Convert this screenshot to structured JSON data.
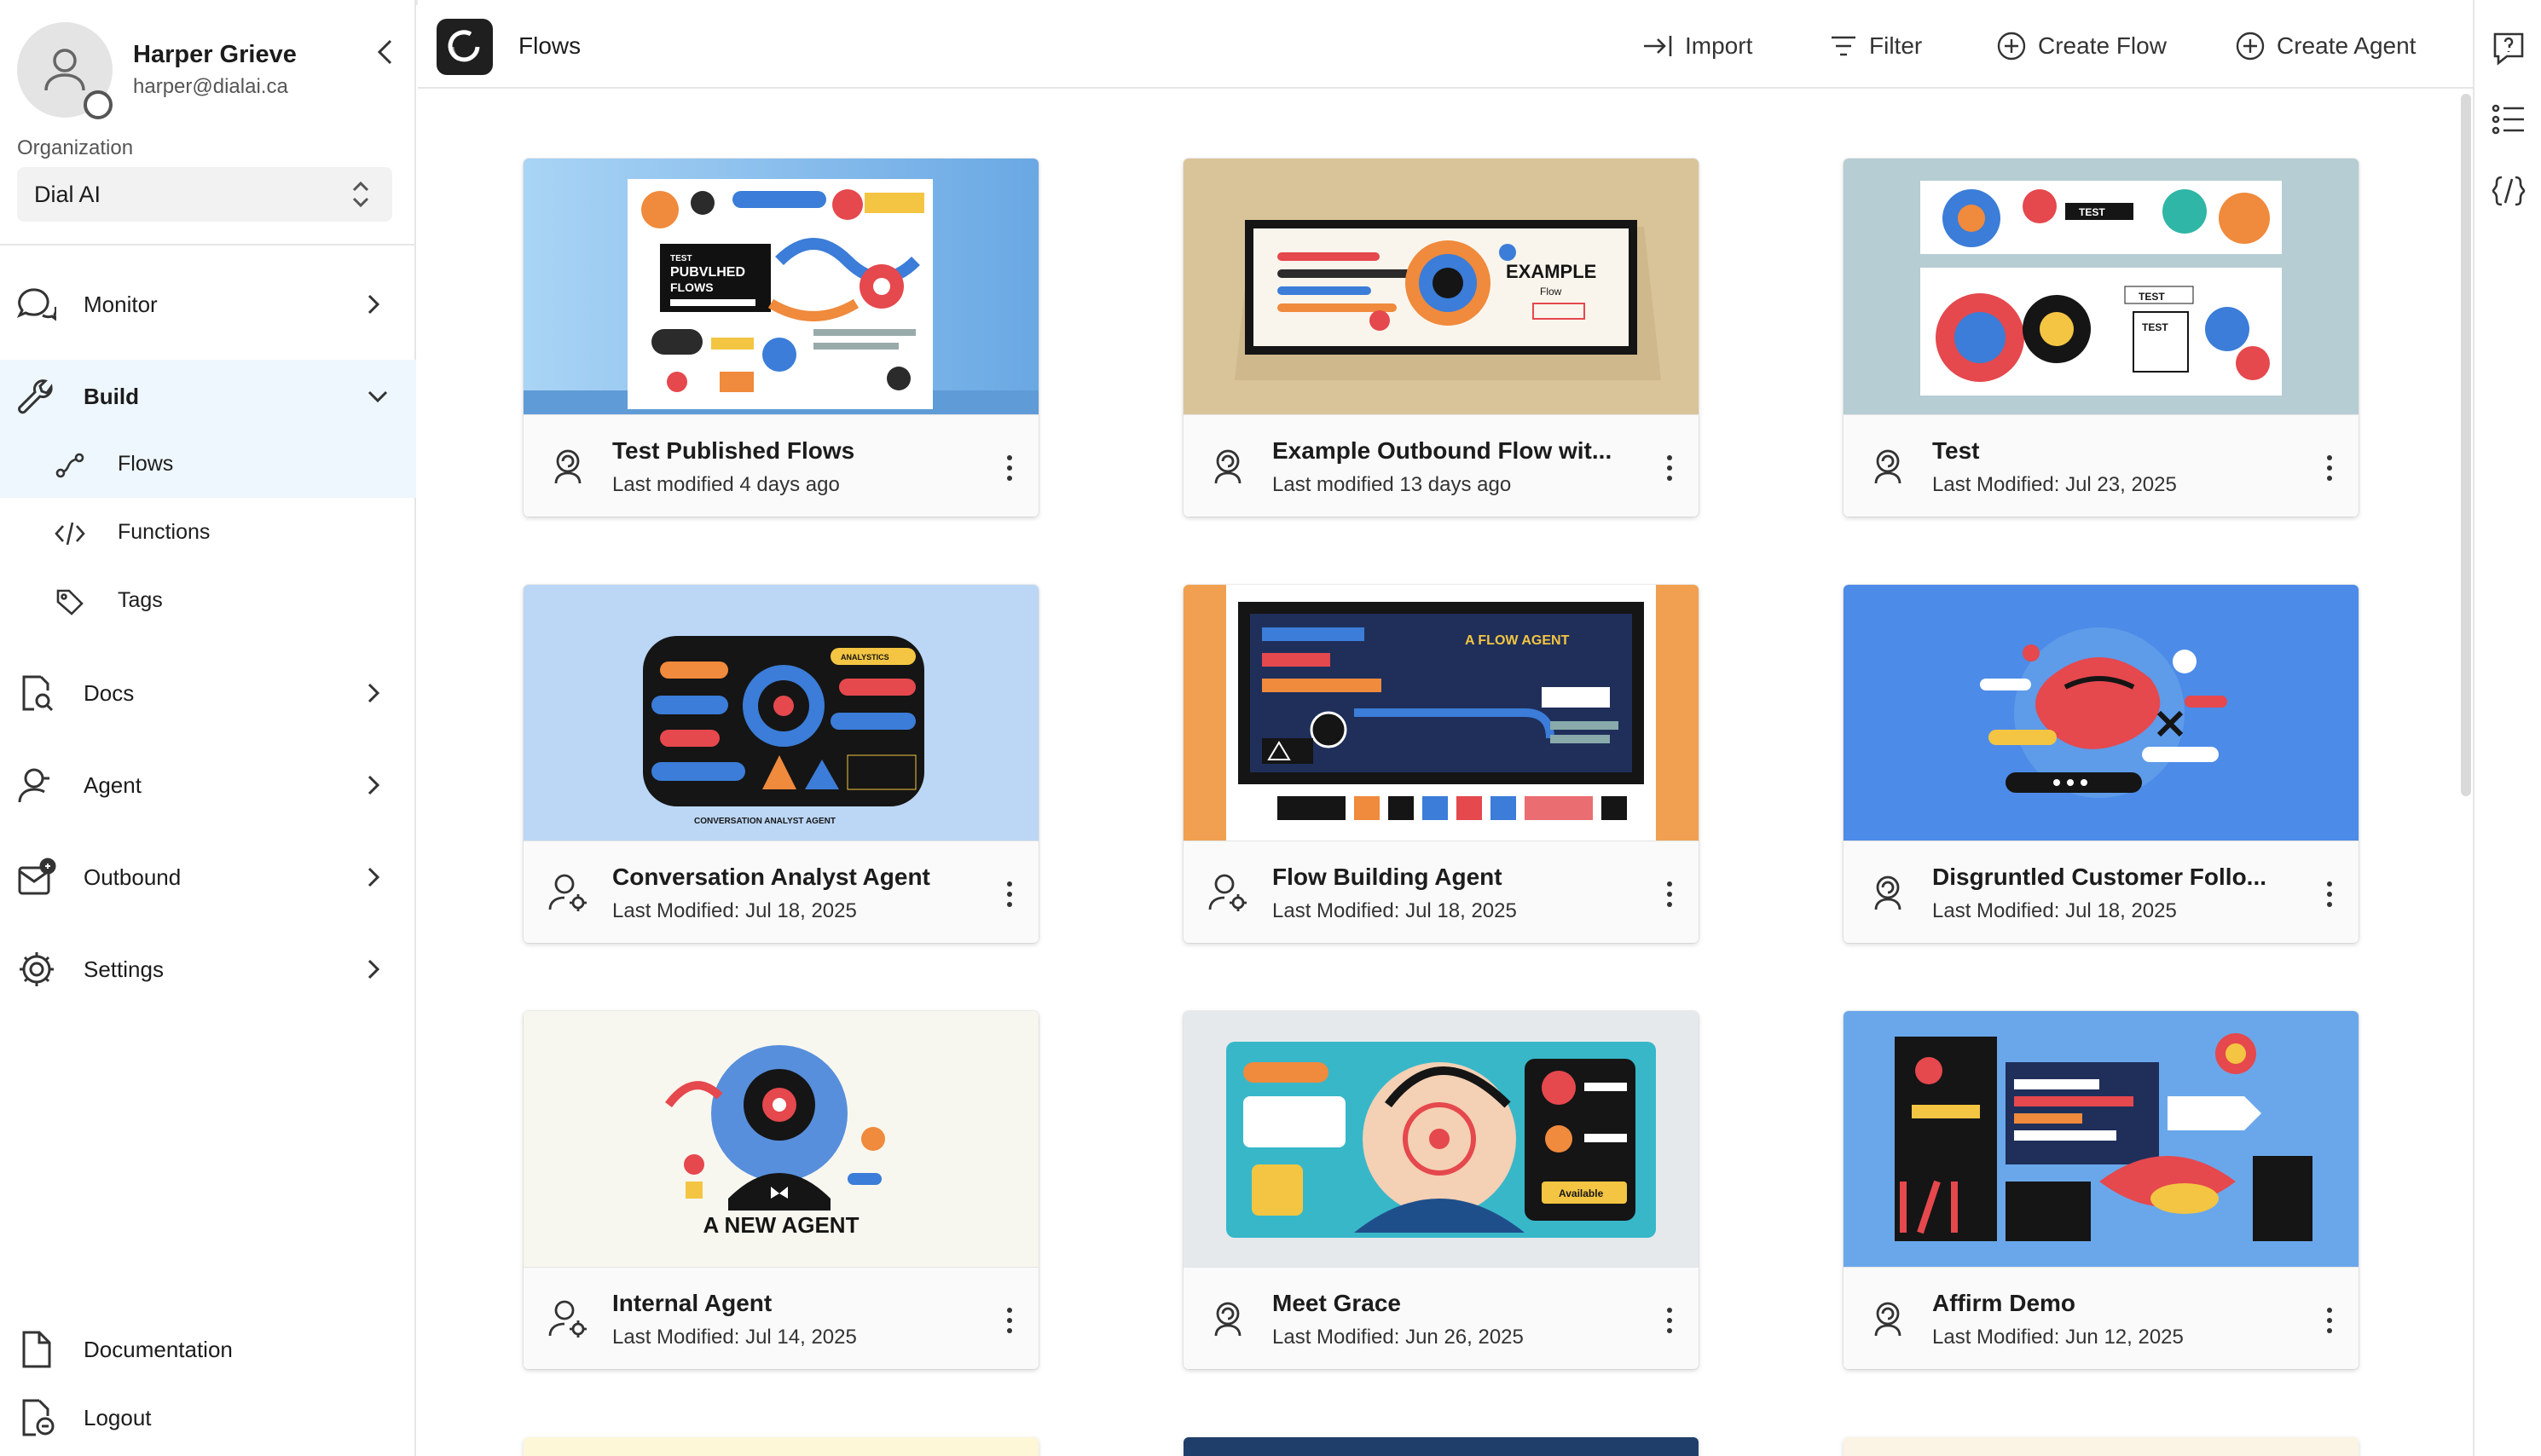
{
  "user": {
    "name": "Harper Grieve",
    "email": "harper@dialai.ca"
  },
  "organization": {
    "label": "Organization",
    "value": "Dial AI"
  },
  "nav": {
    "monitor": "Monitor",
    "build": "Build",
    "flows": "Flows",
    "functions": "Functions",
    "tags": "Tags",
    "docs": "Docs",
    "agent": "Agent",
    "outbound": "Outbound",
    "settings": "Settings",
    "documentation": "Documentation",
    "logout": "Logout"
  },
  "header": {
    "title": "Flows",
    "import": "Import",
    "filter": "Filter",
    "create_flow": "Create Flow",
    "create_agent": "Create Agent"
  },
  "cards": [
    {
      "title": "Test Published Flows",
      "subtitle": "Last modified 4 days ago",
      "icon": "flow-icon",
      "thumb_text": [
        "TEST",
        "PUBVLHED",
        "FLOWS"
      ]
    },
    {
      "title": "Example Outbound Flow wit...",
      "subtitle": "Last modified 13 days ago",
      "icon": "flow-icon",
      "thumb_text": [
        "EXAMPLE",
        "Flow"
      ]
    },
    {
      "title": "Test",
      "subtitle": "Last Modified: Jul 23, 2025",
      "icon": "flow-icon",
      "thumb_text": [
        "TEST",
        "TEST",
        "TEST"
      ]
    },
    {
      "title": "Conversation Analyst Agent",
      "subtitle": "Last Modified: Jul 18, 2025",
      "icon": "agent-icon",
      "thumb_text": [
        "ANALYSTICS",
        "CONVERSATION ANALYST AGENT"
      ]
    },
    {
      "title": "Flow Building Agent",
      "subtitle": "Last Modified: Jul 18, 2025",
      "icon": "agent-icon",
      "thumb_text": [
        "A FLOW AGENT"
      ]
    },
    {
      "title": "Disgruntled Customer Follo...",
      "subtitle": "Last Modified: Jul 18, 2025",
      "icon": "flow-icon",
      "thumb_text": []
    },
    {
      "title": "Internal Agent",
      "subtitle": "Last Modified: Jul 14, 2025",
      "icon": "agent-icon",
      "thumb_text": [
        "A NEW AGENT"
      ]
    },
    {
      "title": "Meet Grace",
      "subtitle": "Last Modified: Jun 26, 2025",
      "icon": "flow-icon",
      "thumb_text": [
        "Available"
      ]
    },
    {
      "title": "Affirm Demo",
      "subtitle": "Last Modified: Jun 12, 2025",
      "icon": "flow-icon",
      "thumb_text": []
    }
  ],
  "colors": {
    "active_nav_bg": "#eef7fd",
    "thumb_blue": "#9fcdf0",
    "thumb_tan": "#d9c49a",
    "thumb_slate": "#b5cdd3",
    "thumb_lightblue": "#bcd7f5",
    "thumb_orange": "#f0a050",
    "thumb_royal": "#4d8be8",
    "thumb_cream": "#f8f7ef",
    "thumb_grey": "#e6e9ec",
    "thumb_sky": "#6aa7ea"
  }
}
